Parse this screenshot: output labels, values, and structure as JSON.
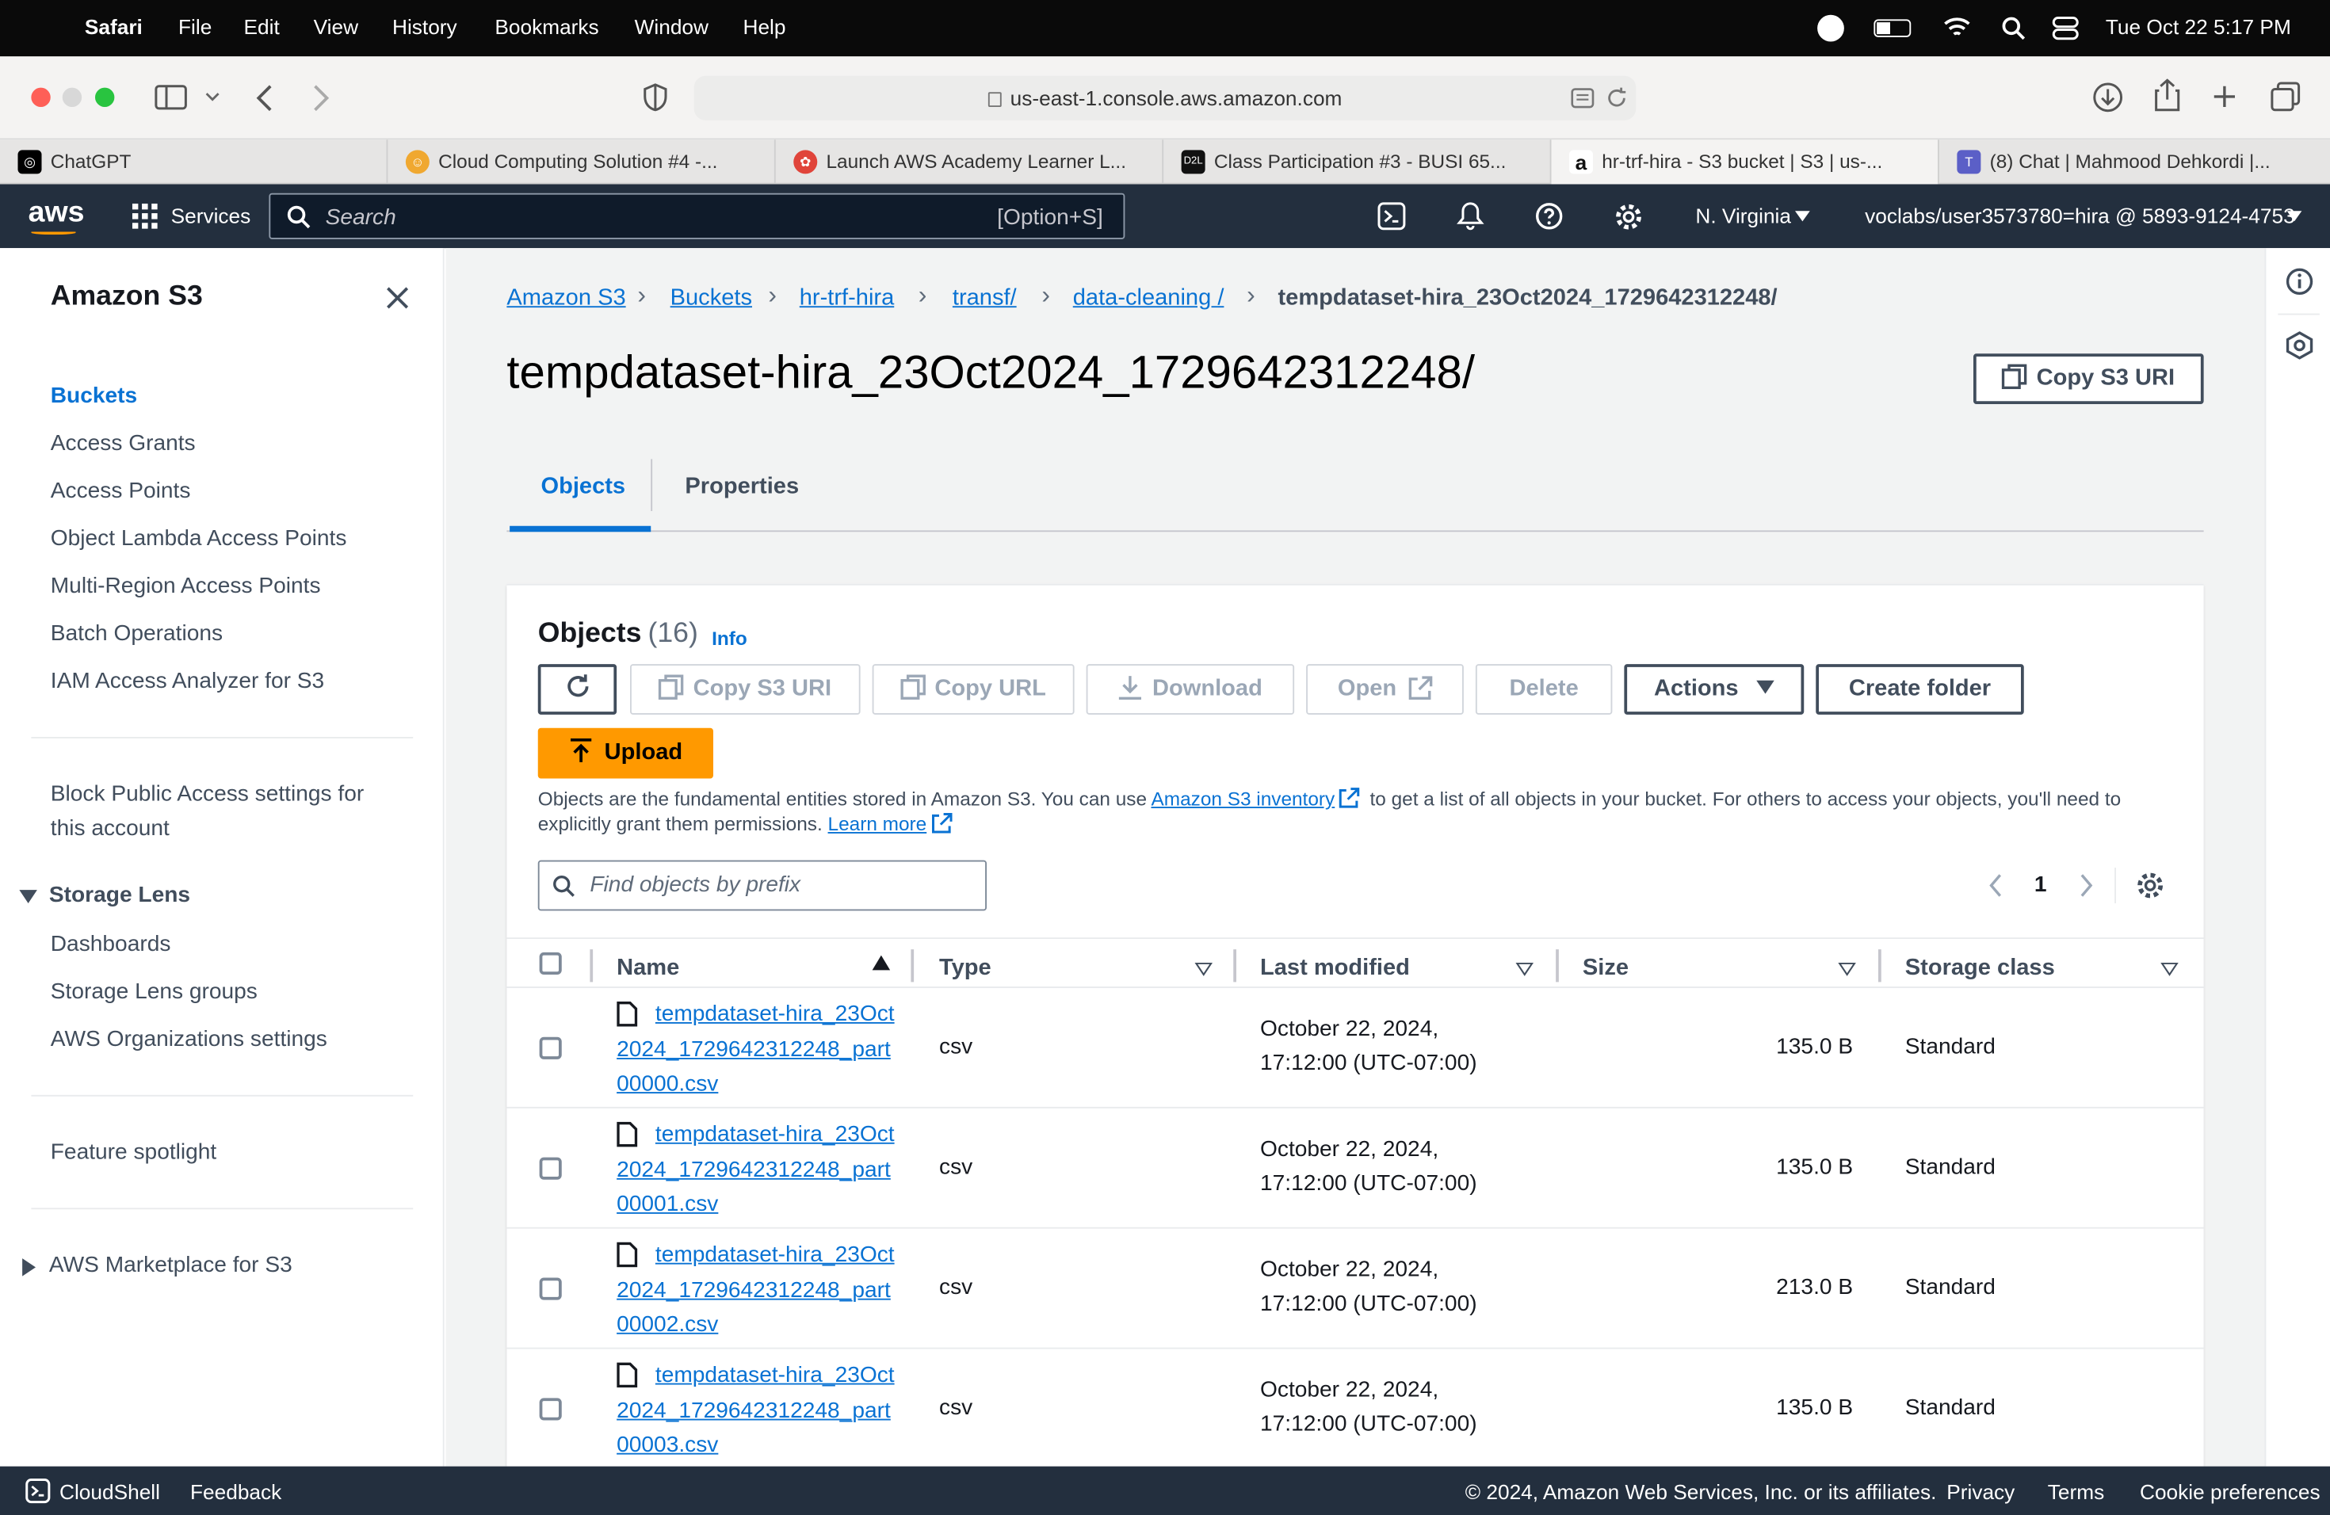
{
  "macos": {
    "app": "Safari",
    "menus": [
      "File",
      "Edit",
      "View",
      "History",
      "Bookmarks",
      "Window",
      "Help"
    ],
    "clock": "Tue Oct 22  5:17 PM"
  },
  "browser": {
    "url": "us-east-1.console.aws.amazon.com",
    "tabs": [
      {
        "title": "ChatGPT",
        "color": "#000000",
        "glyph": "◎"
      },
      {
        "title": "Cloud Computing Solution #4 -...",
        "color": "#f0a830",
        "glyph": "☺"
      },
      {
        "title": "Launch AWS Academy Learner L...",
        "color": "#e0443a",
        "glyph": "✿"
      },
      {
        "title": "Class Participation #3 - BUSI 65...",
        "color": "#111111",
        "glyph": "D2L"
      },
      {
        "title": "hr-trf-hira - S3 bucket | S3 | us-...",
        "color": "#ffffff",
        "glyph": "a"
      },
      {
        "title": "(8) Chat | Mahmood Dehkordi |...",
        "color": "#5b5fc7",
        "glyph": "T"
      }
    ]
  },
  "aws": {
    "logo": "aws",
    "services": "Services",
    "search_placeholder": "Search",
    "search_shortcut": "[Option+S]",
    "region": "N. Virginia",
    "account": "voclabs/user3573780=hira @ 5893-9124-4753"
  },
  "sidebar": {
    "title": "Amazon S3",
    "items": [
      "Buckets",
      "Access Grants",
      "Access Points",
      "Object Lambda Access Points",
      "Multi-Region Access Points",
      "Batch Operations",
      "IAM Access Analyzer for S3"
    ],
    "block_public_1": "Block Public Access settings for",
    "block_public_2": "this account",
    "storage_lens": "Storage Lens",
    "lens_items": [
      "Dashboards",
      "Storage Lens groups",
      "AWS Organizations settings"
    ],
    "feature": "Feature spotlight",
    "marketplace": "AWS Marketplace for S3"
  },
  "breadcrumb": [
    "Amazon S3",
    "Buckets",
    "hr-trf-hira",
    "transf/",
    "data-cleaning /",
    "tempdataset-hira_23Oct2024_1729642312248/"
  ],
  "page": {
    "title": "tempdataset-hira_23Oct2024_1729642312248/",
    "copy_uri": "Copy S3 URI",
    "tabs": [
      "Objects",
      "Properties"
    ]
  },
  "objects": {
    "heading": "Objects",
    "count": "(16)",
    "info": "Info",
    "buttons": {
      "copy_s3_uri": "Copy S3 URI",
      "copy_url": "Copy URL",
      "download": "Download",
      "open": "Open",
      "delete": "Delete",
      "actions": "Actions",
      "create_folder": "Create folder",
      "upload": "Upload"
    },
    "desc_1": "Objects are the fundamental entities stored in Amazon S3. You can use",
    "desc_link": "Amazon S3 inventory",
    "desc_2": "to get a list of all objects in your bucket. For others to access your objects, you'll need to",
    "desc_3": "explicitly grant them permissions.",
    "learn_more": "Learn more",
    "filter_placeholder": "Find objects by prefix",
    "page": "1",
    "columns": [
      "Name",
      "Type",
      "Last modified",
      "Size",
      "Storage class"
    ],
    "rows": [
      {
        "name": "tempdataset-hira_23Oct2024_1729642312248_part00000.csv",
        "type": "csv",
        "modified_1": "October 22, 2024,",
        "modified_2": "17:12:00 (UTC-07:00)",
        "size": "135.0 B",
        "class": "Standard"
      },
      {
        "name": "tempdataset-hira_23Oct2024_1729642312248_part00001.csv",
        "type": "csv",
        "modified_1": "October 22, 2024,",
        "modified_2": "17:12:00 (UTC-07:00)",
        "size": "135.0 B",
        "class": "Standard"
      },
      {
        "name": "tempdataset-hira_23Oct2024_1729642312248_part00002.csv",
        "type": "csv",
        "modified_1": "October 22, 2024,",
        "modified_2": "17:12:00 (UTC-07:00)",
        "size": "213.0 B",
        "class": "Standard"
      },
      {
        "name": "tempdataset-hira_23Oct2024_1729642312248_part00003.csv",
        "type": "csv",
        "modified_1": "October 22, 2024,",
        "modified_2": "17:12:00 (UTC-07:00)",
        "size": "135.0 B",
        "class": "Standard"
      }
    ]
  },
  "footer": {
    "cloudshell": "CloudShell",
    "feedback": "Feedback",
    "copyright": "© 2024, Amazon Web Services, Inc. or its affiliates.",
    "privacy": "Privacy",
    "terms": "Terms",
    "cookies": "Cookie preferences"
  },
  "colors": {
    "aws_nav": "#232f3e",
    "link": "#0972d3",
    "upload": "#ff9900"
  }
}
